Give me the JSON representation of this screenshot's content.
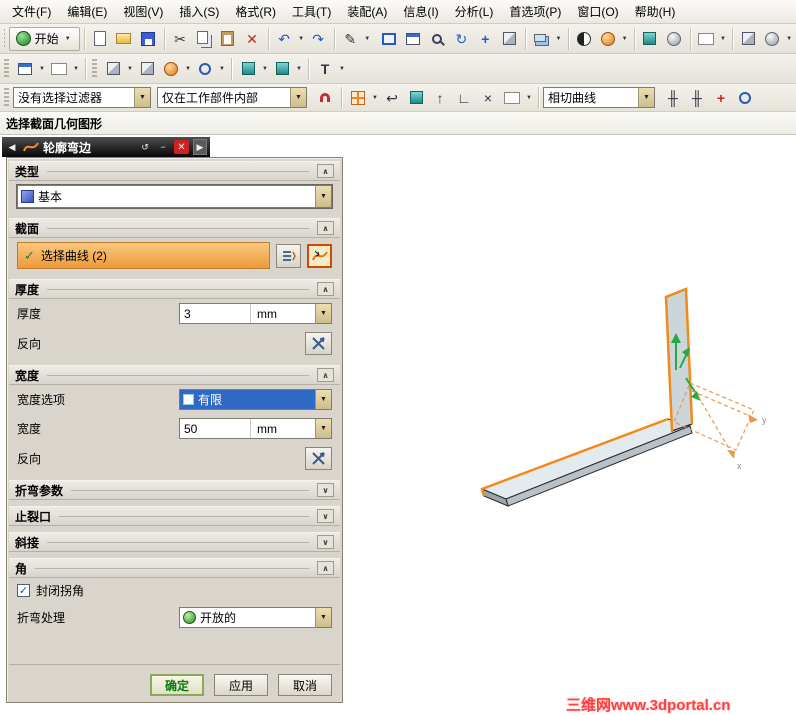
{
  "icons": {
    "dropdown": "▼",
    "chevron_up": "∧",
    "chevron_down": "∨",
    "check": "✓",
    "close": "✕",
    "minimize": "−",
    "back": "◀",
    "forward": "▶",
    "reset": "↺",
    "undo": "↶",
    "redo": "↷",
    "cut": "✂",
    "delete": "✕",
    "rotate": "↻",
    "pan": "+",
    "pen": "✎",
    "hook": "↩",
    "up_arrow": "↑",
    "corner": "∟",
    "times": "×",
    "rail": "╫",
    "text_tool": "T"
  },
  "menu": {
    "items": [
      {
        "label": "文件(F)"
      },
      {
        "label": "编辑(E)"
      },
      {
        "label": "视图(V)"
      },
      {
        "label": "插入(S)"
      },
      {
        "label": "格式(R)"
      },
      {
        "label": "工具(T)"
      },
      {
        "label": "装配(A)"
      },
      {
        "label": "信息(I)"
      },
      {
        "label": "分析(L)"
      },
      {
        "label": "首选项(P)"
      },
      {
        "label": "窗口(O)"
      },
      {
        "label": "帮助(H)"
      }
    ]
  },
  "toolbar": {
    "start_label": "开始"
  },
  "selection_bar": {
    "filter": "没有选择过滤器",
    "scope": "仅在工作部件内部",
    "curve_rule": "相切曲线"
  },
  "prompt": "选择截面几何图形",
  "dialog": {
    "title": "轮廓弯边",
    "type": {
      "header": "类型",
      "value": "基本"
    },
    "section": {
      "header": "截面",
      "select_label": "选择曲线 (2)"
    },
    "thickness": {
      "header": "厚度",
      "label": "厚度",
      "value": "3",
      "unit": "mm",
      "reverse_label": "反向"
    },
    "width": {
      "header": "宽度",
      "option_label": "宽度选项",
      "option_value": "有限",
      "label": "宽度",
      "value": "50",
      "unit": "mm",
      "reverse_label": "反向"
    },
    "bend_params": {
      "header": "折弯参数"
    },
    "relief": {
      "header": "止裂口"
    },
    "miter": {
      "header": "斜接"
    },
    "corner": {
      "header": "角",
      "checkbox_label": "封闭拐角",
      "checked": true,
      "treatment_label": "折弯处理",
      "treatment_value": "开放的"
    },
    "buttons": {
      "ok": "确定",
      "apply": "应用",
      "cancel": "取消"
    }
  },
  "viewport": {
    "axis_x": "x",
    "axis_y": "y"
  },
  "watermark": "三维网www.3dportal.cn",
  "colors": {
    "accent_orange": "#ee9a3c",
    "highlight_blue": "#316ac5",
    "ok_green": "#0a7a0a",
    "edge_orange": "#f08a1a",
    "triad_green": "#22aa44"
  }
}
